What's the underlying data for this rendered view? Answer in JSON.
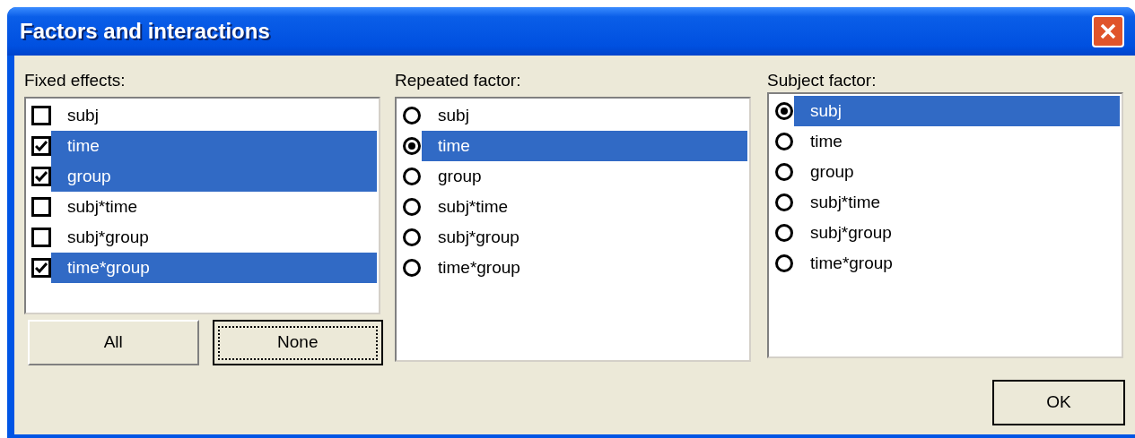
{
  "window": {
    "title": "Factors and interactions"
  },
  "fixed_effects": {
    "label": "Fixed effects:",
    "items": [
      {
        "label": "subj",
        "checked": false,
        "selected": false
      },
      {
        "label": "time",
        "checked": true,
        "selected": true
      },
      {
        "label": "group",
        "checked": true,
        "selected": true
      },
      {
        "label": "subj*time",
        "checked": false,
        "selected": false
      },
      {
        "label": "subj*group",
        "checked": false,
        "selected": false
      },
      {
        "label": "time*group",
        "checked": true,
        "selected": true
      }
    ],
    "buttons": [
      {
        "label": "All",
        "focused": false
      },
      {
        "label": "None",
        "focused": true
      }
    ]
  },
  "repeated_factor": {
    "label": "Repeated factor:",
    "items": [
      {
        "label": "subj",
        "selected": false
      },
      {
        "label": "time",
        "selected": true
      },
      {
        "label": "group",
        "selected": false
      },
      {
        "label": "subj*time",
        "selected": false
      },
      {
        "label": "subj*group",
        "selected": false
      },
      {
        "label": "time*group",
        "selected": false
      }
    ]
  },
  "subject_factor": {
    "label": "Subject factor:",
    "items": [
      {
        "label": "subj",
        "selected": true
      },
      {
        "label": "time",
        "selected": false
      },
      {
        "label": "group",
        "selected": false
      },
      {
        "label": "subj*time",
        "selected": false
      },
      {
        "label": "subj*group",
        "selected": false
      },
      {
        "label": "time*group",
        "selected": false
      }
    ]
  },
  "ok_button": {
    "label": "OK"
  }
}
